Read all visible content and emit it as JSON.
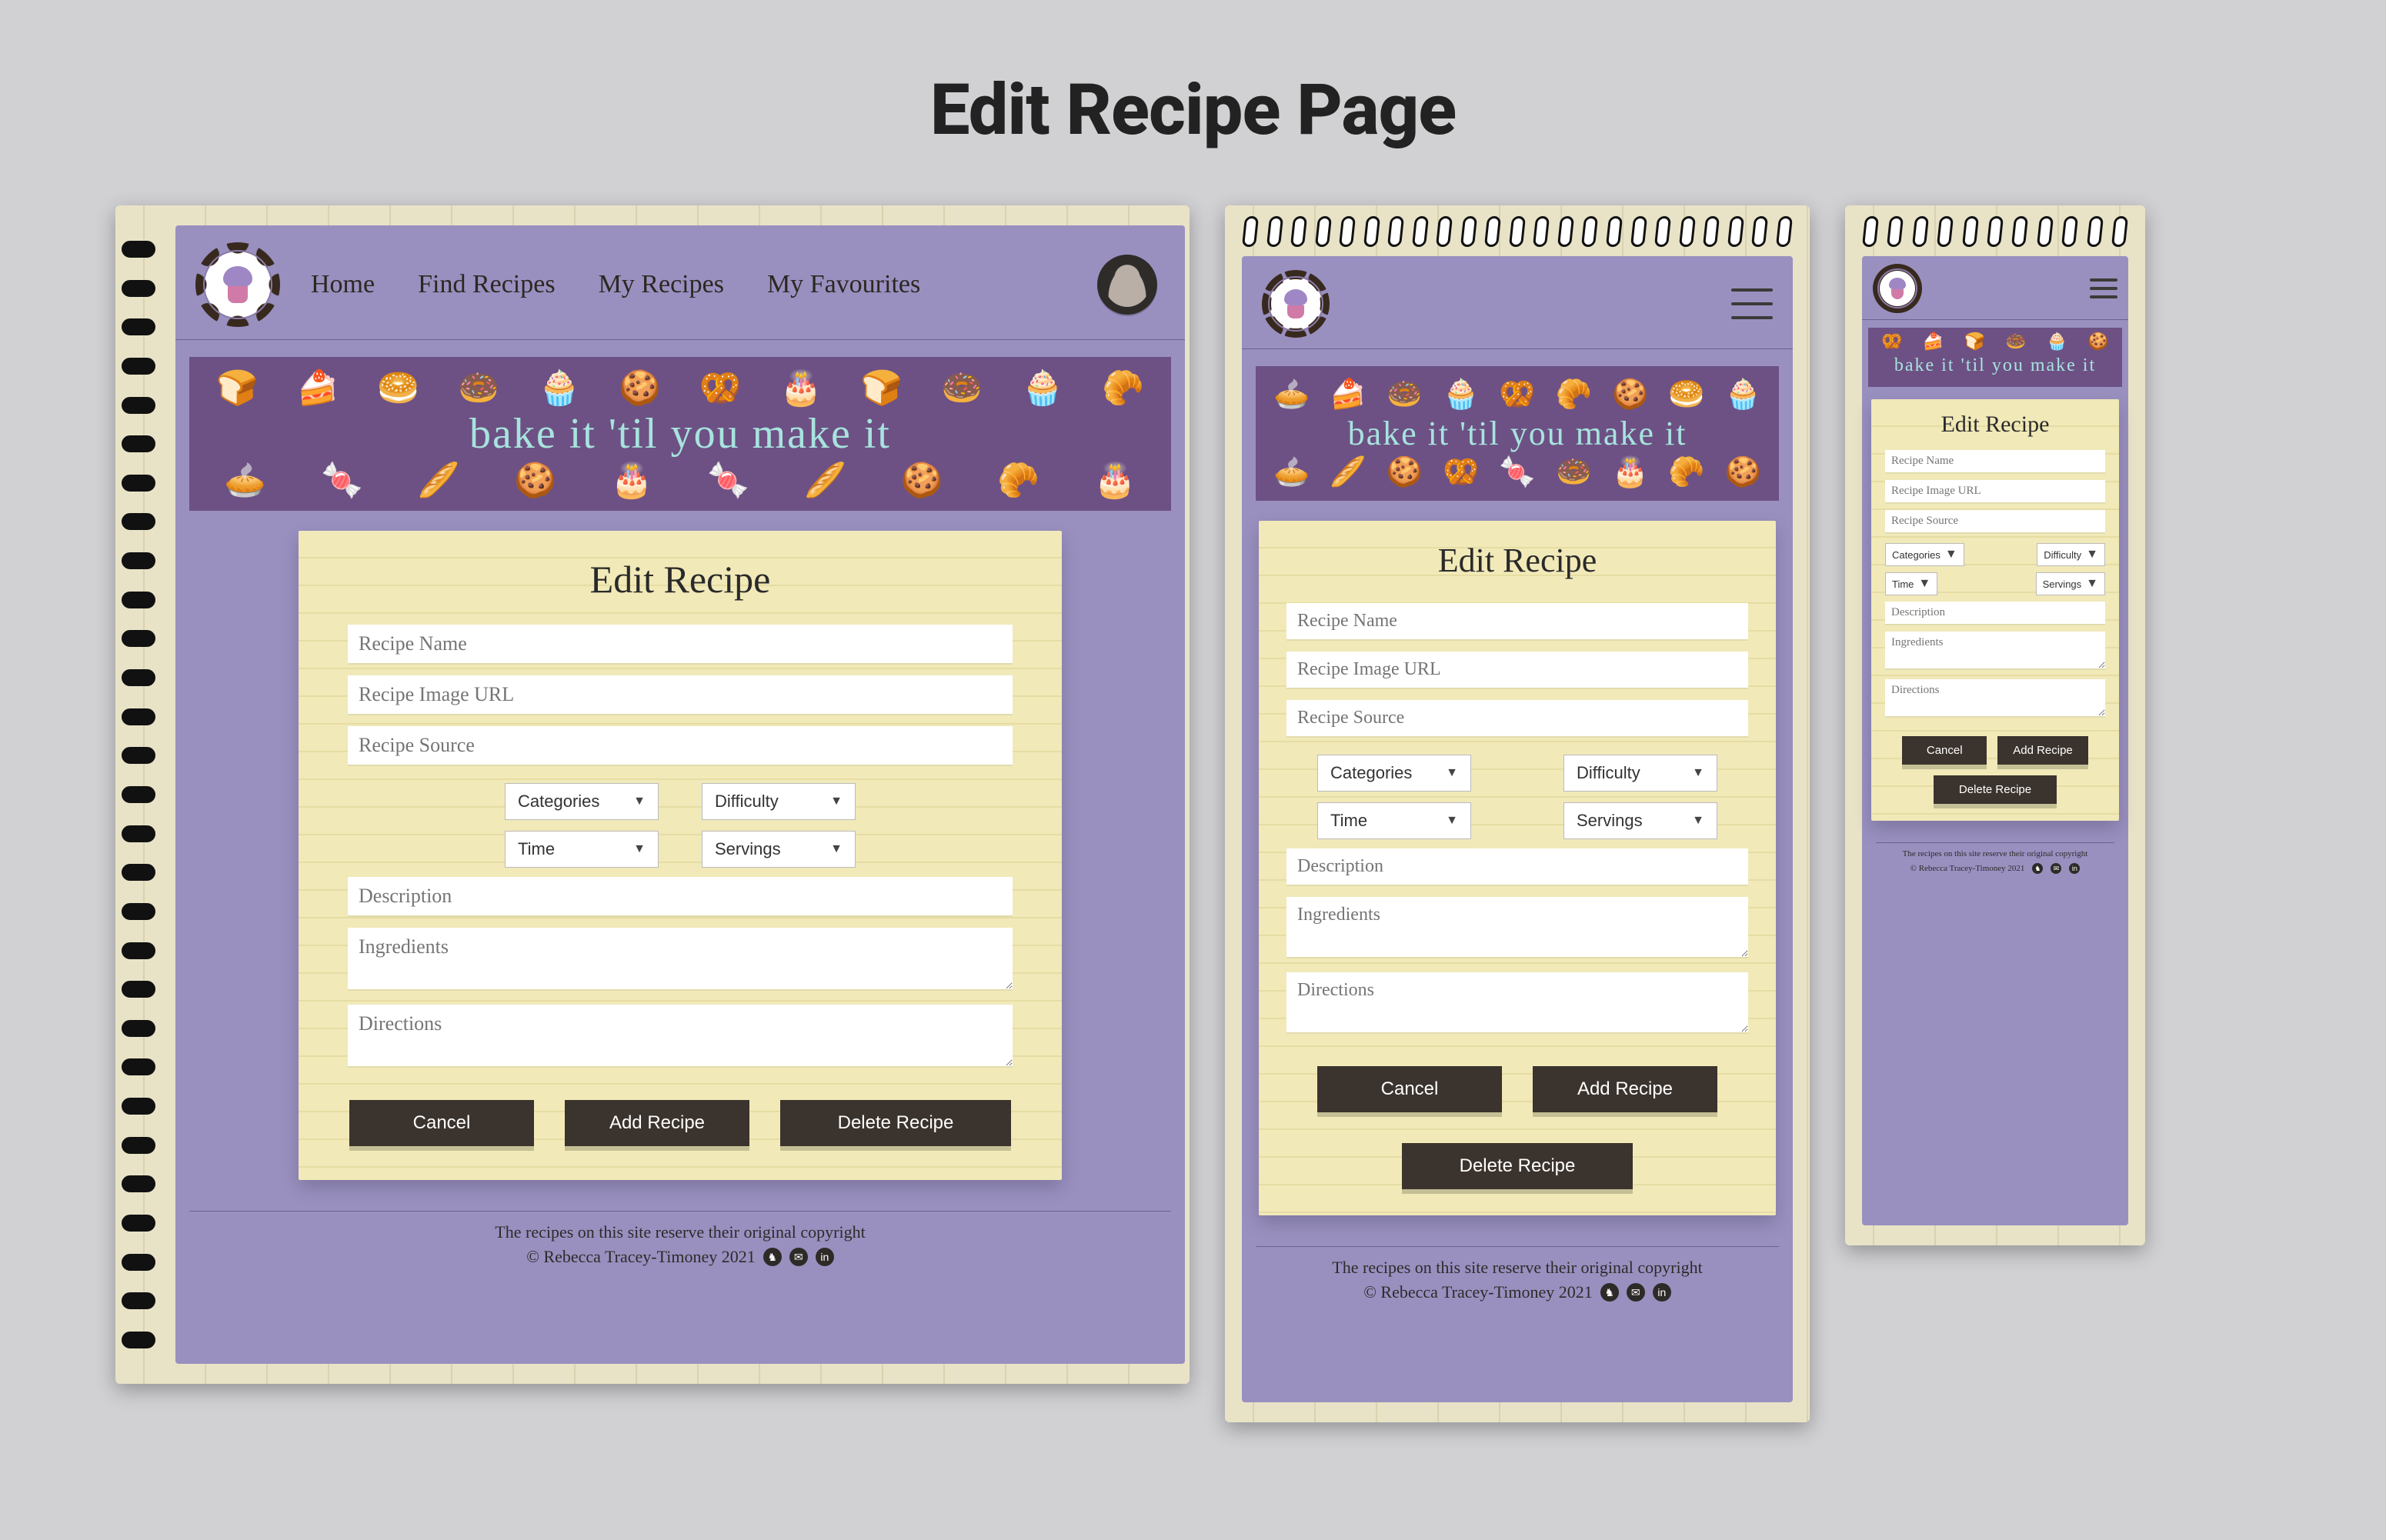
{
  "page_title": "Edit Recipe Page",
  "tagline": "bake it 'til you make it",
  "nav": {
    "home": "Home",
    "find": "Find Recipes",
    "mine": "My Recipes",
    "fav": "My Favourites"
  },
  "form": {
    "heading": "Edit Recipe",
    "name_ph": "Recipe Name",
    "image_ph": "Recipe Image URL",
    "source_ph": "Recipe Source",
    "dd_categories": "Categories",
    "dd_difficulty": "Difficulty",
    "dd_time": "Time",
    "dd_servings": "Servings",
    "description_ph": "Description",
    "ingredients_ph": "Ingredients",
    "directions_ph": "Directions",
    "btn_cancel": "Cancel",
    "btn_add": "Add Recipe",
    "btn_delete": "Delete Recipe"
  },
  "footer": {
    "copyright_notice": "The recipes on this site reserve their original copyright",
    "credit": "© Rebecca Tracey-Timoney 2021"
  }
}
